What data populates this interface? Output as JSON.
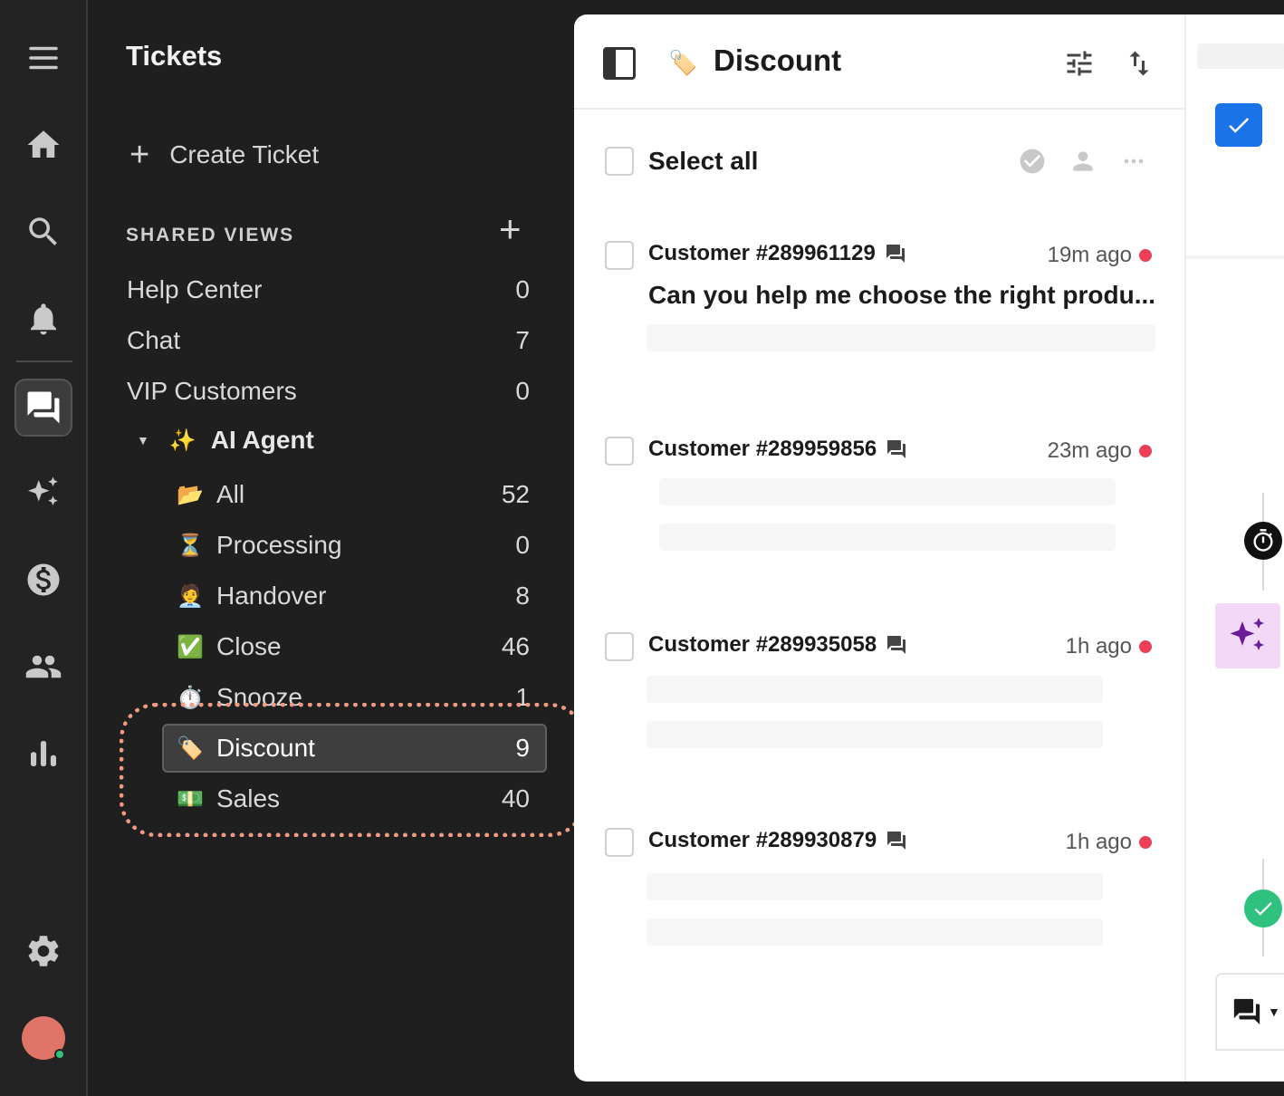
{
  "rail": {
    "items": [
      {
        "icon": "menu-icon"
      },
      {
        "icon": "home-icon"
      },
      {
        "icon": "search-icon"
      },
      {
        "icon": "bell-icon"
      },
      {
        "icon": "tickets-chat-icon",
        "active": true
      },
      {
        "icon": "sparkles-icon"
      },
      {
        "icon": "dollar-icon"
      },
      {
        "icon": "people-icon"
      },
      {
        "icon": "bar-chart-icon"
      },
      {
        "icon": "gear-icon"
      }
    ],
    "avatar_color": "#e07468",
    "status_color": "#2ec27e"
  },
  "panel": {
    "title": "Tickets",
    "create_label": "Create Ticket",
    "shared_views_label": "SHARED VIEWS",
    "views": [
      {
        "label": "Help Center",
        "count": "0"
      },
      {
        "label": "Chat",
        "count": "7"
      },
      {
        "label": "VIP Customers",
        "count": "0"
      }
    ],
    "ai_group": {
      "emoji": "✨",
      "label": "AI Agent"
    },
    "ai_views": [
      {
        "emoji": "📂",
        "label": "All",
        "count": "52"
      },
      {
        "emoji": "⏳",
        "label": "Processing",
        "count": "0"
      },
      {
        "emoji": "🧑‍💼",
        "label": "Handover",
        "count": "8"
      },
      {
        "emoji": "✅",
        "label": "Close",
        "count": "46"
      },
      {
        "emoji": "⏱️",
        "label": "Snooze",
        "count": "1"
      },
      {
        "emoji": "🏷️",
        "label": "Discount",
        "count": "9",
        "selected": true
      },
      {
        "emoji": "💵",
        "label": "Sales",
        "count": "40"
      }
    ],
    "highlight_color": "#f09a82"
  },
  "main": {
    "header_emoji": "🏷️",
    "title": "Discount",
    "select_all_label": "Select all",
    "tickets": [
      {
        "customer": "Customer #289961129",
        "time": "19m ago",
        "preview": "Can you help me choose the right produ..."
      },
      {
        "customer": "Customer #289959856",
        "time": "23m ago"
      },
      {
        "customer": "Customer #289935058",
        "time": "1h ago"
      },
      {
        "customer": "Customer #289930879",
        "time": "1h ago"
      }
    ],
    "unread_dot_color": "#ec4057"
  },
  "right": {
    "accent": "#1a73e8",
    "ai_bg": "#f3d7f7",
    "done_color": "#2ec27e"
  }
}
